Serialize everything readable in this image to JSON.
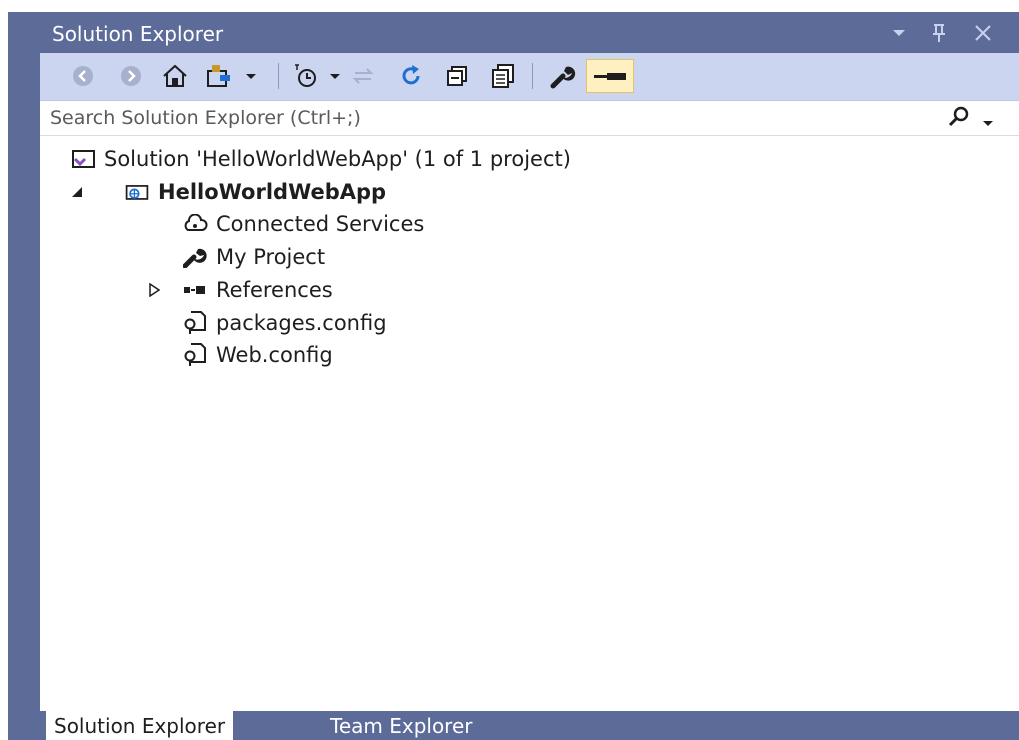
{
  "window": {
    "title": "Solution Explorer",
    "controls": [
      "dropdown-caret",
      "pin-icon",
      "close-icon"
    ]
  },
  "toolbar": {
    "buttons": [
      "back-icon",
      "forward-icon",
      "home-icon",
      "switch-views-icon",
      "pending-changes-icon",
      "sync-icon",
      "refresh-icon",
      "collapse-all-icon",
      "show-all-files-icon",
      "properties-icon",
      "preview-selected-icon"
    ]
  },
  "search": {
    "placeholder": "Search Solution Explorer (Ctrl+;)"
  },
  "tree": {
    "solution": "Solution 'HelloWorldWebApp' (1 of 1 project)",
    "project": "HelloWorldWebApp",
    "items": [
      {
        "label": "Connected Services",
        "icon": "cloud-services-icon"
      },
      {
        "label": "My Project",
        "icon": "wrench-icon"
      },
      {
        "label": "References",
        "icon": "references-icon",
        "expandable": true
      },
      {
        "label": "packages.config",
        "icon": "config-file-icon"
      },
      {
        "label": "Web.config",
        "icon": "config-file-icon"
      }
    ]
  },
  "bottom_tabs": {
    "solution_explorer": "Solution Explorer",
    "team_explorer": "Team Explorer"
  },
  "colors": {
    "chrome": "#5d6b99",
    "toolbar": "#ccd5f0",
    "active_button": "#fff0c2",
    "refresh_blue": "#1e6fd1"
  }
}
